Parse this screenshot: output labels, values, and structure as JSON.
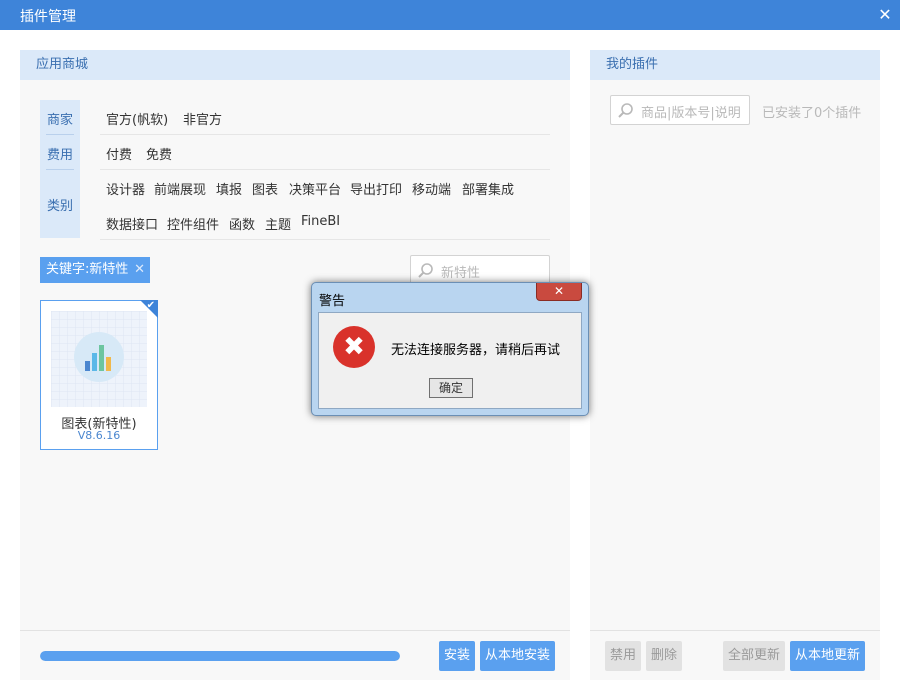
{
  "window": {
    "title": "插件管理",
    "close": "✕"
  },
  "store": {
    "header": "应用商城",
    "filters": {
      "merchant_label": "商家",
      "fee_label": "费用",
      "category_label": "类别",
      "merchant_options": [
        "官方(帆软)",
        "非官方"
      ],
      "fee_options": [
        "付费",
        "免费"
      ],
      "category_options_row1": [
        "设计器",
        "前端展现",
        "填报",
        "图表",
        "决策平台",
        "导出打印",
        "移动端",
        "部署集成"
      ],
      "category_options_row2": [
        "数据接口",
        "控件组件",
        "函数",
        "主题",
        "FineBI"
      ]
    },
    "keyword_tag": "关键字:新特性",
    "keyword_close": "✕",
    "search_placeholder": "新特性",
    "plugins": [
      {
        "name": "图表(新特性)",
        "version": "V8.6.16",
        "selected": true,
        "check": "✔"
      }
    ],
    "progress": 1.0,
    "install_button": "安装",
    "local_install_button": "从本地安装"
  },
  "mine": {
    "header": "我的插件",
    "search_placeholder": "商品|版本号|说明",
    "installed_count": "已安装了0个插件",
    "disable_button": "禁用",
    "delete_button": "删除",
    "update_all_button": "全部更新",
    "local_update_button": "从本地更新"
  },
  "dialog": {
    "title": "警告",
    "close": "✕",
    "error_icon": "✖",
    "message": "无法连接服务器，请稍后再试",
    "ok_button": "确定"
  },
  "colors": {
    "accent": "#3e84d9",
    "button": "#5aa0ef",
    "error": "#d9322b"
  }
}
